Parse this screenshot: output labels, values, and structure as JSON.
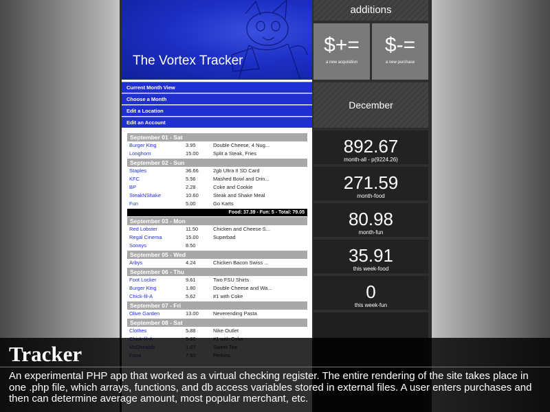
{
  "banner": {
    "title": "The Vortex Tracker"
  },
  "nav": [
    "Current Month View",
    "Choose a Month",
    "Edit a Location",
    "Edit an Account"
  ],
  "log": {
    "days": [
      {
        "header": "September 01 - Sat",
        "entries": [
          {
            "merchant": "Burger King",
            "amount": "3.95",
            "desc": "Double Cheese, 4 Nug..."
          },
          {
            "merchant": "Longhorn",
            "amount": "15.00",
            "desc": "Split a Steak, Fries"
          }
        ]
      },
      {
        "header": "September 02 - Sun",
        "entries": [
          {
            "merchant": "Staples",
            "amount": "36.66",
            "desc": "2gb Ultra II SD Card"
          },
          {
            "merchant": "KFC",
            "amount": "5.56",
            "desc": "Mashed Bowl and Drin..."
          },
          {
            "merchant": "BP",
            "amount": "2.28",
            "desc": "Coke and Cookie"
          },
          {
            "merchant": "SteakNShake",
            "amount": "10.60",
            "desc": "Steak and Shake Meal"
          },
          {
            "merchant": "Fun",
            "amount": "5.00",
            "desc": "Go Karts"
          }
        ],
        "totals": "Food: 37.39 - Fun: 5 - Total: 79.05"
      },
      {
        "header": "September 03 - Mon",
        "entries": [
          {
            "merchant": "Red Lobster",
            "amount": "11.50",
            "desc": "Chicken and Cheese S..."
          },
          {
            "merchant": "Regal Cinema",
            "amount": "15.00",
            "desc": "Superbad"
          },
          {
            "merchant": "Sonnys",
            "amount": "8.50",
            "desc": ""
          }
        ]
      },
      {
        "header": "September 05 - Wed",
        "entries": [
          {
            "merchant": "Arbys",
            "amount": "4.24",
            "desc": "Chicken Bacon Swiss ..."
          }
        ]
      },
      {
        "header": "September 06 - Thu",
        "entries": [
          {
            "merchant": "Foot Locker",
            "amount": "9.61",
            "desc": "Two FSU Shirts"
          },
          {
            "merchant": "Burger King",
            "amount": "1.80",
            "desc": "Double Cheese and Wa..."
          },
          {
            "merchant": "Chick-fil-A",
            "amount": "5.62",
            "desc": "#1 with Coke"
          }
        ]
      },
      {
        "header": "September 07 - Fri",
        "entries": [
          {
            "merchant": "Olive Garden",
            "amount": "13.00",
            "desc": "Neverending Pasta"
          }
        ]
      },
      {
        "header": "September 08 - Sat",
        "entries": [
          {
            "merchant": "Clothes",
            "amount": "5.88",
            "desc": "Nike Outlet"
          },
          {
            "merchant": "Chick-fil-A",
            "amount": "5.60",
            "desc": "#1 with Coke"
          },
          {
            "merchant": "McDonalds",
            "amount": "1.07",
            "desc": "Sweet Tea"
          },
          {
            "merchant": "Food",
            "amount": "7.50",
            "desc": "Perkins"
          }
        ]
      }
    ]
  },
  "right": {
    "additions": "additions",
    "add_symbol": "$+=",
    "add_label": "a new acquisition",
    "sub_symbol": "$-=",
    "sub_label": "a new purchase",
    "month": "December",
    "stats": [
      {
        "value": "892.67",
        "label": "month-all - p(9224.26)"
      },
      {
        "value": "271.59",
        "label": "month-food"
      },
      {
        "value": "80.98",
        "label": "month-fun"
      },
      {
        "value": "35.91",
        "label": "this week-food"
      },
      {
        "value": "0",
        "label": "this week-fun"
      }
    ]
  },
  "caption": {
    "title": "Tracker",
    "body": "An experimental PHP app that worked as a virtual checking register. The entire rendering of the site takes place in one .php file, which arrays, functions, and db access variables stored in external files. A user enters purchases and then can determine average amount, most popular merchant, etc."
  }
}
